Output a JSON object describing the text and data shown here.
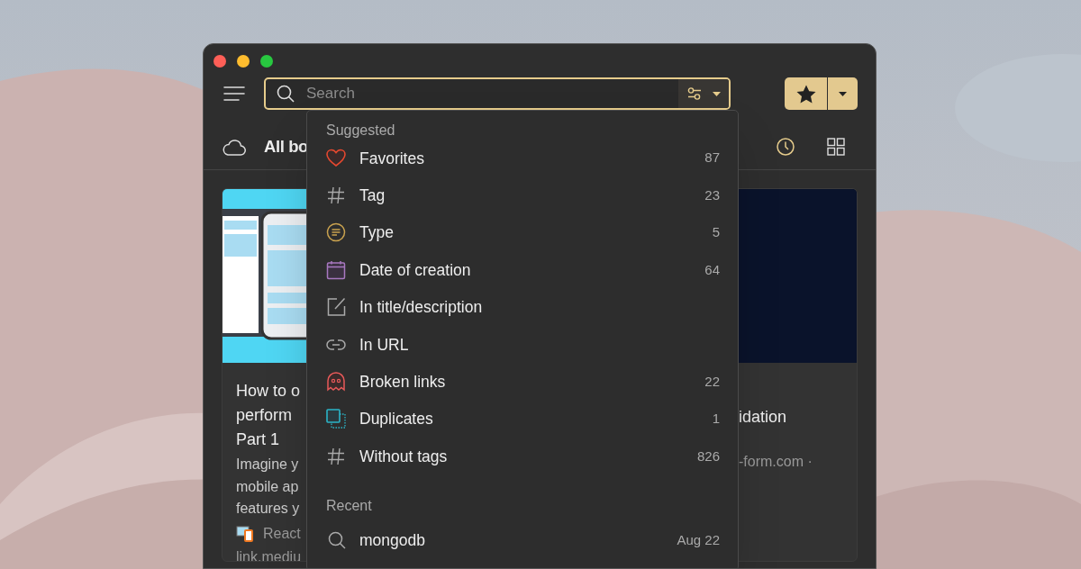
{
  "search": {
    "placeholder": "Search"
  },
  "header": {
    "title": "All bo"
  },
  "cards": [
    {
      "title_lines": [
        "How to o",
        "perform",
        "Part 1"
      ],
      "description_lines": [
        "Imagine y",
        "mobile ap",
        "features y"
      ],
      "source": "React",
      "domain": "link.mediu"
    },
    {
      "title_lines": [
        "idation"
      ],
      "domain": "-form.com ·"
    }
  ],
  "dropdown": {
    "suggested_label": "Suggested",
    "suggested": [
      {
        "kind": "heart",
        "label": "Favorites",
        "count": "87"
      },
      {
        "kind": "hash",
        "label": "Tag",
        "count": "23"
      },
      {
        "kind": "type",
        "label": "Type",
        "count": "5"
      },
      {
        "kind": "calendar",
        "label": "Date of creation",
        "count": "64"
      },
      {
        "kind": "edit",
        "label": "In title/description"
      },
      {
        "kind": "link",
        "label": "In URL"
      },
      {
        "kind": "ghost",
        "label": "Broken links",
        "count": "22"
      },
      {
        "kind": "duplicate",
        "label": "Duplicates",
        "count": "1"
      },
      {
        "kind": "hash",
        "label": "Without tags",
        "count": "826"
      }
    ],
    "recent_label": "Recent",
    "recent": [
      {
        "label": "mongodb",
        "date": "Aug 22"
      }
    ]
  }
}
